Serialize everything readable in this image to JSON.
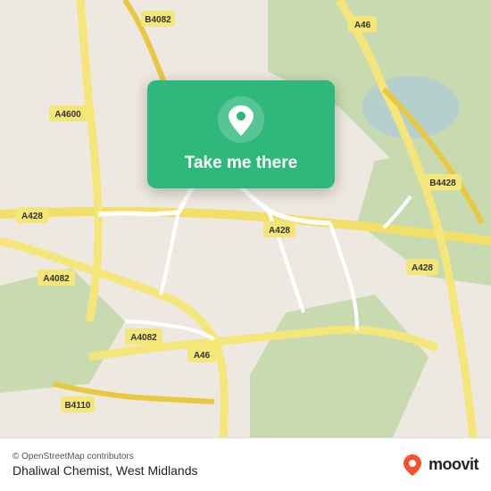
{
  "map": {
    "alt": "Street map of West Midlands area showing roads and landmarks"
  },
  "cta": {
    "label": "Take me there",
    "pin_icon": "location-pin-icon"
  },
  "footer": {
    "attribution": "© OpenStreetMap contributors",
    "location_name": "Dhaliwal Chemist, West Midlands",
    "moovit_wordmark": "moovit"
  },
  "road_labels": [
    "A46",
    "A4600",
    "A428",
    "A4082",
    "A46",
    "B4082",
    "B4428",
    "B4110"
  ],
  "colors": {
    "map_bg": "#e8e0d8",
    "green_area": "#c8dab0",
    "road_yellow": "#f5e67a",
    "road_white": "#ffffff",
    "cta_green": "#2eb87c",
    "text_dark": "#222222"
  }
}
